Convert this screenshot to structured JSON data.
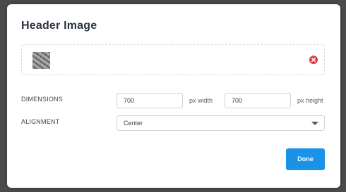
{
  "dialog": {
    "title": "Header Image"
  },
  "image": {
    "thumbnail": "header-image-thumbnail",
    "remove_icon": "remove-circle-icon",
    "remove_color": "#e03b3b"
  },
  "dimensions": {
    "label": "DIMENSIONS",
    "width_value": "700",
    "width_unit": "px width",
    "height_value": "700",
    "height_unit": "px height"
  },
  "alignment": {
    "label": "ALIGNMENT",
    "selected": "Center"
  },
  "actions": {
    "done_label": "Done",
    "done_color": "#1893e8"
  }
}
